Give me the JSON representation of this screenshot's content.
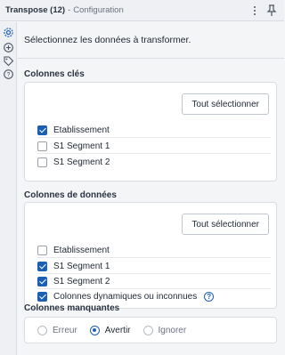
{
  "header": {
    "title": "Transpose (12)",
    "separator": "-",
    "subtitle": "Configuration",
    "menu_icon": "more-vertical-icon",
    "pin_icon": "pin-icon"
  },
  "rail": {
    "icons": [
      "gear-icon",
      "plus-circle-icon",
      "tag-icon",
      "help-circle-icon"
    ]
  },
  "intro": "Sélectionnez les données à transformer.",
  "key_columns": {
    "title": "Colonnes clés",
    "select_all_label": "Tout sélectionner",
    "items": [
      {
        "label": "Etablissement",
        "checked": true
      },
      {
        "label": "S1 Segment 1",
        "checked": false
      },
      {
        "label": "S1 Segment 2",
        "checked": false
      }
    ]
  },
  "data_columns": {
    "title": "Colonnes de données",
    "select_all_label": "Tout sélectionner",
    "items": [
      {
        "label": "Etablissement",
        "checked": false
      },
      {
        "label": "S1 Segment 1",
        "checked": true
      },
      {
        "label": "S1 Segment 2",
        "checked": true
      },
      {
        "label": "Colonnes dynamiques ou inconnues",
        "checked": true,
        "help": "?"
      }
    ]
  },
  "missing_columns": {
    "title": "Colonnes manquantes",
    "options": [
      {
        "label": "Erreur",
        "selected": false
      },
      {
        "label": "Avertir",
        "selected": true
      },
      {
        "label": "Ignorer",
        "selected": false
      }
    ]
  },
  "colors": {
    "accent": "#1b5fb4",
    "background": "#f4f5f7",
    "panel": "#ffffff",
    "border": "#d9dde3"
  }
}
